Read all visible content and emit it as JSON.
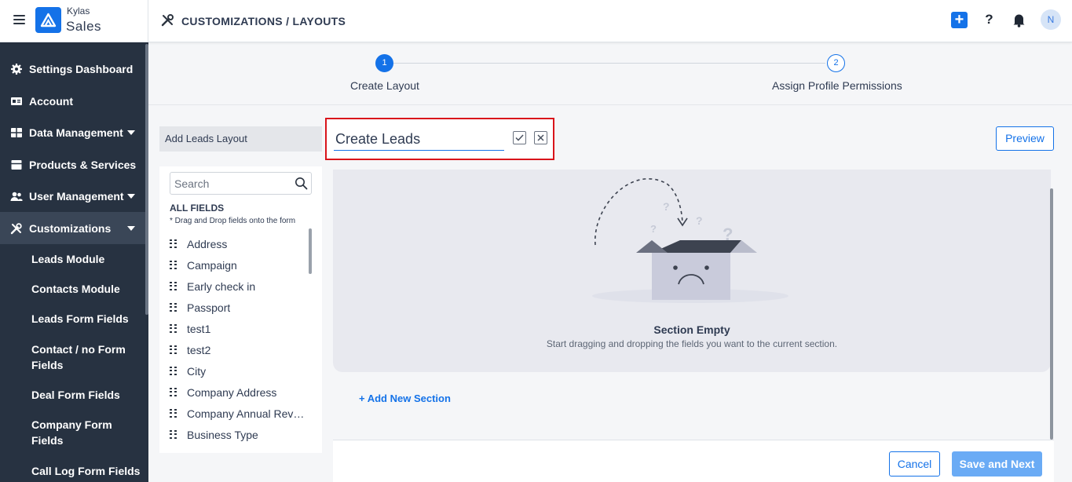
{
  "header": {
    "brand_small": "Kylas",
    "brand_big": "Sales",
    "breadcrumb": "CUSTOMIZATIONS / LAYOUTS",
    "help_label": "?",
    "avatar_initial": "N",
    "accent_color": "#1472e8"
  },
  "sidebar": {
    "items": [
      {
        "label": "Settings Dashboard",
        "icon": "gear-icon"
      },
      {
        "label": "Account",
        "icon": "id-card-icon"
      },
      {
        "label": "Data Management",
        "icon": "table-icon"
      },
      {
        "label": "Products & Services",
        "icon": "box-icon"
      },
      {
        "label": "User Management",
        "icon": "users-icon"
      },
      {
        "label": "Customizations",
        "icon": "tools-icon"
      }
    ],
    "sub_items": [
      "Leads Module",
      "Contacts Module",
      "Leads Form Fields",
      "Contact / no Form Fields",
      "Deal Form Fields",
      "Company Form Fields",
      "Call Log Form Fields"
    ]
  },
  "stepper": {
    "steps": [
      {
        "number": "1",
        "label": "Create Layout"
      },
      {
        "number": "2",
        "label": "Assign Profile Permissions"
      }
    ]
  },
  "fields_panel": {
    "layout_type": "Add Leads Layout",
    "search_placeholder": "Search",
    "heading": "ALL FIELDS",
    "hint": "* Drag and Drop fields onto the form",
    "fields": [
      "Address",
      "Campaign",
      "Early check in",
      "Passport",
      "test1",
      "test2",
      "City",
      "Company Address",
      "Company Annual Revenue",
      "Business Type"
    ]
  },
  "editor": {
    "layout_name": "Create Leads",
    "preview_label": "Preview",
    "empty_title": "Section Empty",
    "empty_subtitle": "Start dragging and dropping the fields you want to the current section.",
    "add_section": "+ Add New Section"
  },
  "footer": {
    "cancel_label": "Cancel",
    "save_label": "Save and Next"
  }
}
